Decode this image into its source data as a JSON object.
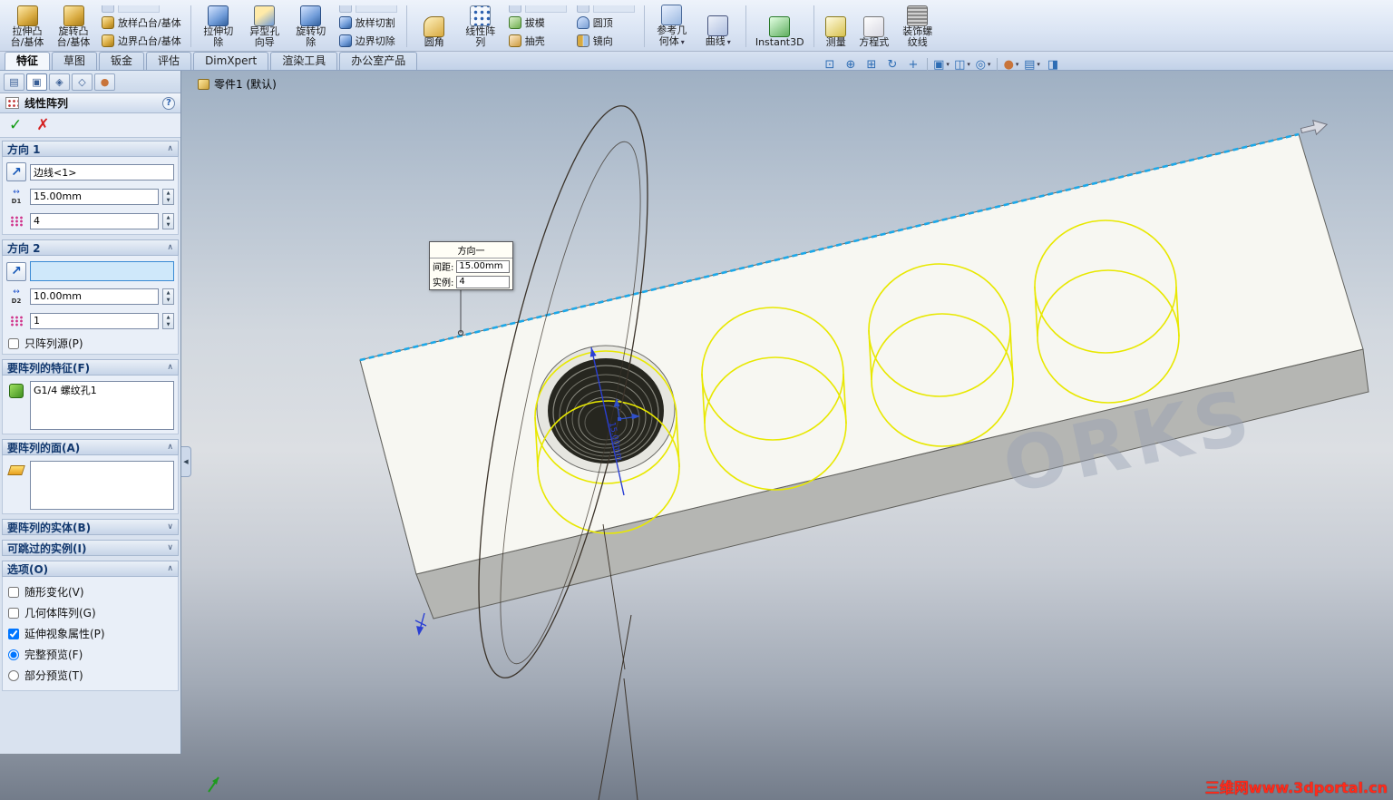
{
  "icons": {
    "spin_up": "▲",
    "spin_down": "▼",
    "check": "✓",
    "cancel": "✗",
    "help": "?",
    "chev_up": "∧",
    "chev_down": "∨",
    "dir_arrow": "↗",
    "caret_down": "▾",
    "collapse_left": "◀",
    "spacing_arrow": "↔",
    "d1": "D1",
    "d2": "D2",
    "zoom_fit": "⊡",
    "zoom_area": "⊞",
    "zoom_inout": "⊕",
    "rotate_view": "↻",
    "pan": "+",
    "orientation": "▣",
    "display_style": "◫",
    "hide_show": "◎",
    "appearance": "●",
    "scene": "▤",
    "section_view": "◨",
    "pm_tab_tree": "▤",
    "pm_tab_prop": "▣",
    "pm_tab_config": "◈",
    "pm_tab_dimxpert": "◇",
    "pm_tab_display": "●"
  },
  "ribbon": {
    "extrude_boss1": "拉伸凸",
    "extrude_boss2": "台/基体",
    "revolve_boss1": "旋转凸",
    "revolve_boss2": "台/基体",
    "loft_boss": "放样凸台/基体",
    "boundary_boss": "边界凸台/基体",
    "extrude_cut1": "拉伸切",
    "extrude_cut2": "除",
    "hole_wizard1": "异型孔",
    "hole_wizard2": "向导",
    "revolve_cut1": "旋转切",
    "revolve_cut2": "除",
    "loft_cut": "放样切割",
    "boundary_cut": "边界切除",
    "fillet": "圆角",
    "linear_pattern1": "线性阵",
    "linear_pattern2": "列",
    "draft": "拔模",
    "shell": "抽壳",
    "dome": "圆顶",
    "mirror": "镜向",
    "ref_geo1": "参考几",
    "ref_geo2": "何体",
    "curves": "曲线",
    "instant3d": "Instant3D",
    "measure": "测量",
    "equations": "方程式",
    "thread1": "装饰螺",
    "thread2": "纹线"
  },
  "tabs": {
    "t0": "特征",
    "t1": "草图",
    "t2": "钣金",
    "t3": "评估",
    "t4": "DimXpert",
    "t5": "渲染工具",
    "t6": "办公室产品"
  },
  "pm": {
    "title": "线性阵列",
    "dir1": {
      "header": "方向 1",
      "edge": "边线<1>",
      "spacing": "15.00mm",
      "count": "4"
    },
    "dir2": {
      "header": "方向 2",
      "edge": "",
      "spacing": "10.00mm",
      "count": "1",
      "only_source": "只阵列源(P)",
      "only_source_checked": false
    },
    "features": {
      "header": "要阵列的特征(F)",
      "item0": "G1/4 螺纹孔1"
    },
    "faces": {
      "header": "要阵列的面(A)"
    },
    "bodies": {
      "header": "要阵列的实体(B)"
    },
    "skip": {
      "header": "可跳过的实例(I)"
    },
    "options": {
      "header": "选项(O)",
      "vary": "随形变化(V)",
      "vary_checked": false,
      "geom": "几何体阵列(G)",
      "geom_checked": false,
      "visual": "延伸视象属性(P)",
      "visual_checked": true,
      "full": "完整预览(F)",
      "full_checked": true,
      "partial": "部分预览(T)",
      "partial_checked": false
    }
  },
  "viewport": {
    "tree_root": "零件1 (默认)",
    "callout": {
      "title": "方向一",
      "spacing_label": "间距:",
      "spacing_value": "15.00mm",
      "count_label": "实例:",
      "count_value": "4"
    },
    "dim_label": "15.00mm",
    "watermark": "ORKS",
    "site_watermark": "三维网www.3dportal.cn"
  }
}
